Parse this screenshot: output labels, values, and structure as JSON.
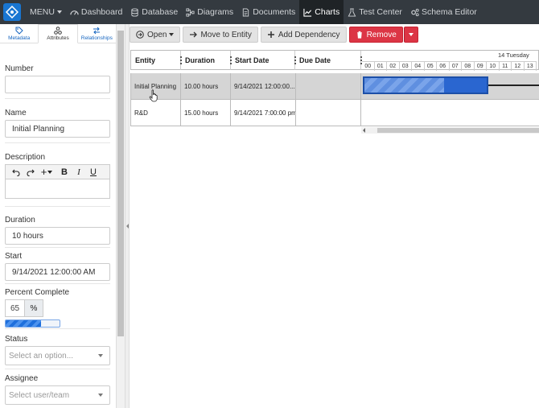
{
  "nav": {
    "menu_label": "MENU",
    "items": [
      {
        "label": "Dashboard",
        "icon": "dashboard-icon"
      },
      {
        "label": "Database",
        "icon": "database-icon"
      },
      {
        "label": "Diagrams",
        "icon": "diagram-icon"
      },
      {
        "label": "Documents",
        "icon": "document-icon"
      },
      {
        "label": "Charts",
        "icon": "chart-icon",
        "active": true
      },
      {
        "label": "Test Center",
        "icon": "flask-icon"
      },
      {
        "label": "Schema Editor",
        "icon": "gears-icon"
      }
    ]
  },
  "left_tabs": [
    {
      "label": "Metadata",
      "icon": "tag-icon"
    },
    {
      "label": "Attributes",
      "icon": "attributes-icon",
      "active": true
    },
    {
      "label": "Relationships",
      "icon": "swap-icon"
    }
  ],
  "form": {
    "number_label": "Number",
    "number_value": "",
    "name_label": "Name",
    "name_value": "Initial Planning",
    "description_label": "Description",
    "duration_label": "Duration",
    "duration_value": "10 hours",
    "start_label": "Start",
    "start_value": "9/14/2021 12:00:00 AM",
    "percent_label": "Percent Complete",
    "percent_value": "65",
    "percent_unit": "%",
    "percent_fraction": 0.65,
    "status_label": "Status",
    "status_placeholder": "Select an option...",
    "assignee_label": "Assignee",
    "assignee_placeholder": "Select user/team"
  },
  "toolbar": {
    "open_label": "Open",
    "move_label": "Move to Entity",
    "add_dep_label": "Add Dependency",
    "remove_label": "Remove"
  },
  "table": {
    "columns": [
      "Entity",
      "Duration",
      "Start Date",
      "Due Date"
    ],
    "rows": [
      {
        "entity": "Initial Planning",
        "duration": "10.00 hours",
        "start": "9/14/2021 12:00:00...",
        "due": "",
        "progress": 0.65
      },
      {
        "entity": "R&D",
        "duration": "15.00 hours",
        "start": "9/14/2021 7:00:00 pm",
        "due": ""
      }
    ]
  },
  "timeline": {
    "date_label": "14 Tuesday",
    "hours": [
      "00",
      "01",
      "02",
      "03",
      "04",
      "05",
      "06",
      "07",
      "08",
      "09",
      "10",
      "11",
      "12",
      "13"
    ]
  },
  "colors": {
    "nav_bg": "#343a40",
    "accent": "#1976d2",
    "danger": "#dc3545",
    "gantt_bar": "#2a66d0"
  }
}
